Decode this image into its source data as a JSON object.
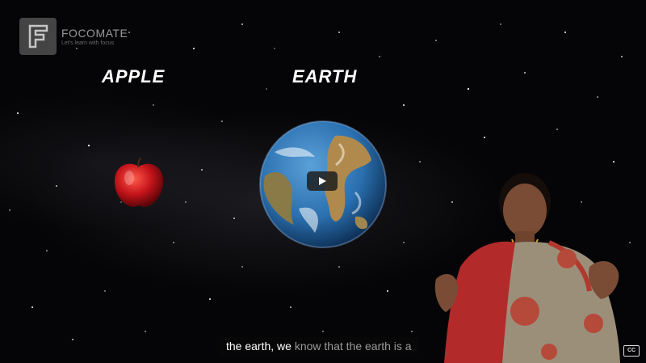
{
  "brand": {
    "name": "FOCOMATE",
    "tagline": "Let's learn with focus"
  },
  "scene": {
    "apple_label": "APPLE",
    "earth_label": "EARTH"
  },
  "caption": {
    "spoken": "the earth, we",
    "upcoming": "know that the earth is a"
  },
  "controls": {
    "cc_label": "CC",
    "play_icon": "play-icon"
  },
  "colors": {
    "background": "#050507",
    "apple_red": "#c4141b",
    "ocean_blue": "#2a6fae",
    "caption_bg": "#080808"
  }
}
